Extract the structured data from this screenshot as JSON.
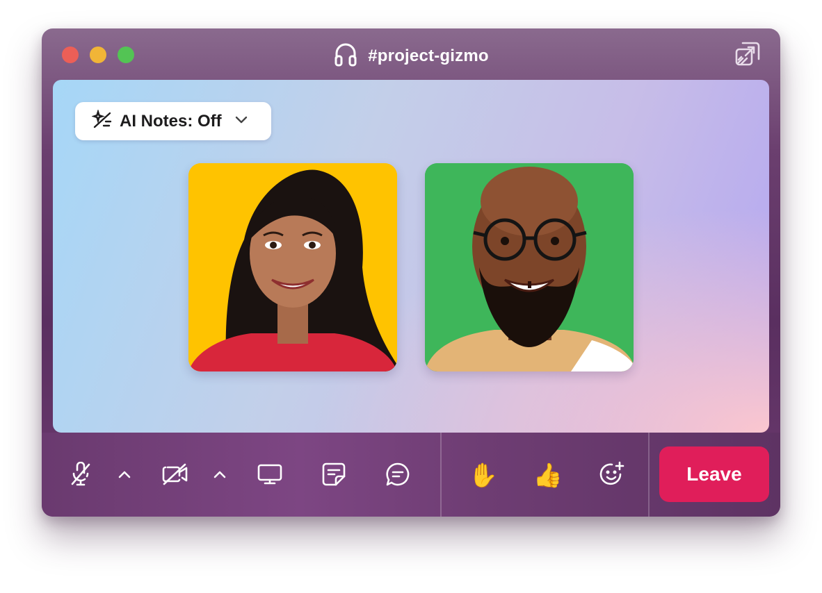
{
  "window": {
    "title": "#project-gizmo",
    "title_icon": "headphones-icon",
    "popout_icon": "popout-icon"
  },
  "stage": {
    "ai_notes": {
      "label": "AI Notes: Off",
      "icon": "sparkle-slash-icon",
      "chevron": "chevron-down-icon"
    },
    "participants": [
      {
        "tile_color": "#ffc300"
      },
      {
        "tile_color": "#3eb65a"
      }
    ]
  },
  "toolbar": {
    "buttons": [
      {
        "name": "mute-mic",
        "icon": "mic-off-icon"
      },
      {
        "name": "mic-options",
        "icon": "chevron-up-icon"
      },
      {
        "name": "camera-off",
        "icon": "video-off-icon"
      },
      {
        "name": "camera-options",
        "icon": "chevron-up-icon"
      },
      {
        "name": "share-screen",
        "icon": "monitor-icon"
      },
      {
        "name": "notes",
        "icon": "note-icon"
      },
      {
        "name": "chat",
        "icon": "chat-icon"
      },
      {
        "name": "raise-hand",
        "icon": "raised-hand-emoji",
        "glyph": "✋"
      },
      {
        "name": "thumbs-up",
        "icon": "thumbs-up-emoji",
        "glyph": "👍"
      },
      {
        "name": "add-reaction",
        "icon": "emoji-add-icon"
      }
    ],
    "leave_label": "Leave"
  },
  "colors": {
    "leave": "#e01e5a",
    "traffic_red": "#ec5f57",
    "traffic_yellow": "#f1b537",
    "traffic_green": "#53c454"
  }
}
